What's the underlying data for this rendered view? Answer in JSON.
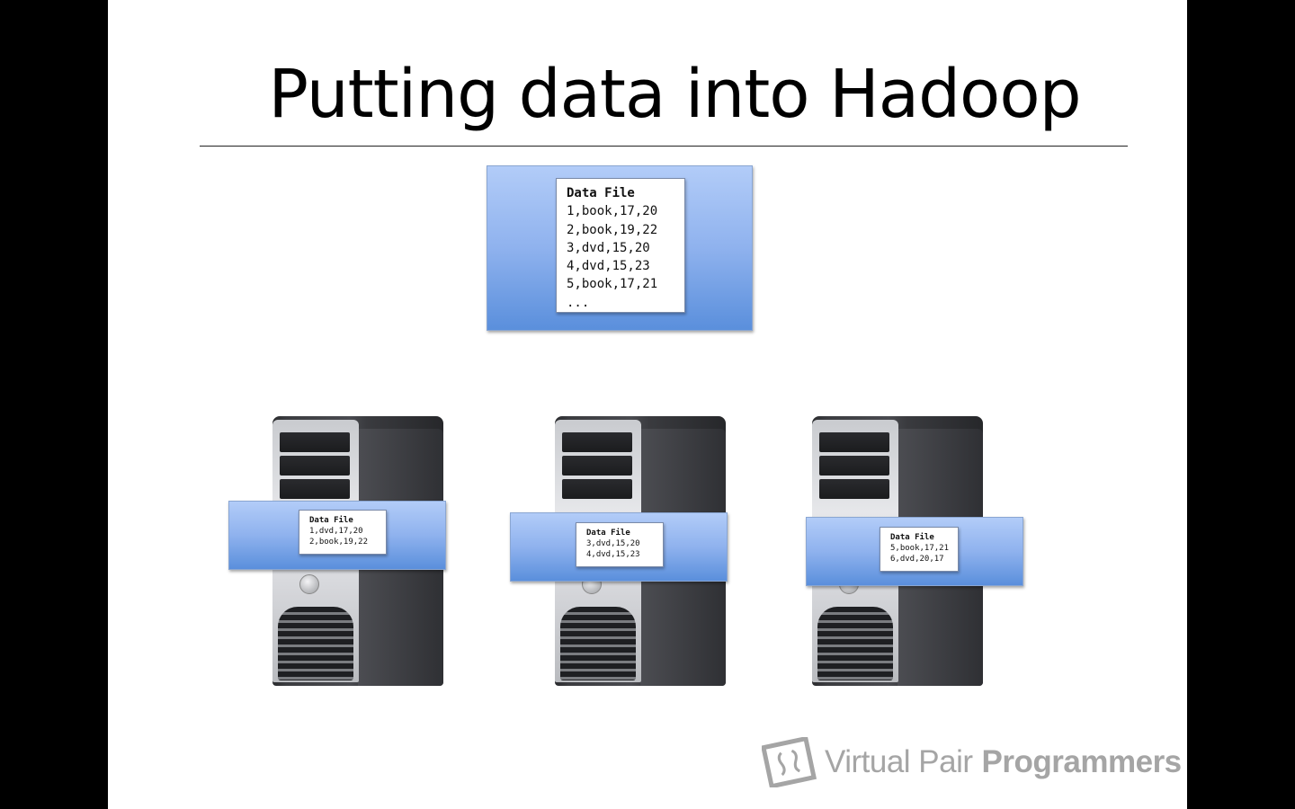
{
  "slide": {
    "title": "Putting data into Hadoop"
  },
  "source_file": {
    "header": "Data File",
    "lines": [
      "1,book,17,20",
      "2,book,19,22",
      "3,dvd,15,20",
      "4,dvd,15,23",
      "5,book,17,21",
      "..."
    ]
  },
  "nodes": [
    {
      "header": "Data File",
      "lines": [
        "1,dvd,17,20",
        "2,book,19,22"
      ]
    },
    {
      "header": "Data File",
      "lines": [
        "3,dvd,15,20",
        "4,dvd,15,23"
      ]
    },
    {
      "header": "Data File",
      "lines": [
        "5,book,17,21",
        "6,dvd,20,17"
      ]
    }
  ],
  "branding": {
    "brand_light": "Virtual Pair",
    "brand_bold": "Programmers"
  },
  "colors": {
    "banner_blue": "#8fb2ee",
    "logo_gray": "#a5a5a5"
  }
}
